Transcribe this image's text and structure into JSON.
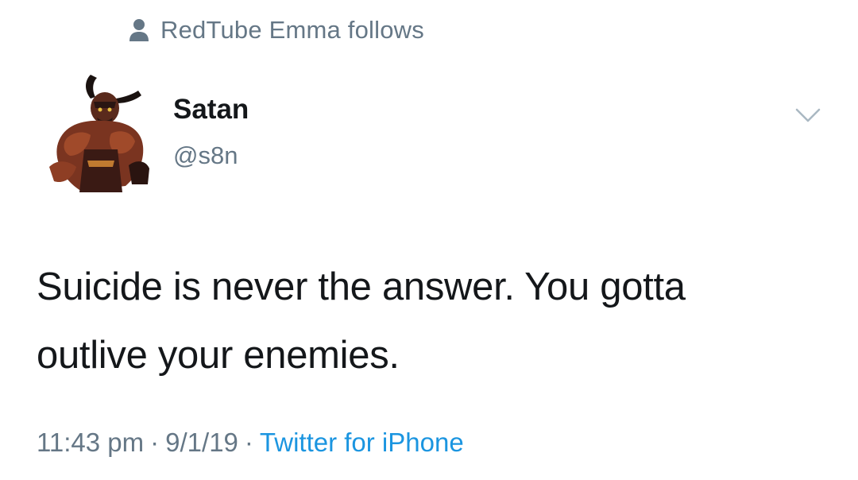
{
  "context": {
    "icon": "person-icon",
    "text": "RedTube Emma follows"
  },
  "author": {
    "avatar_icon": "demon-avatar",
    "display_name": "Satan",
    "handle": "@s8n"
  },
  "menu": {
    "icon": "chevron-down-icon"
  },
  "tweet": {
    "line1": "Suicide is never the answer. You gotta",
    "line2": "outlive your enemies."
  },
  "meta": {
    "time": "11:43 pm",
    "separator": "·",
    "date": "9/1/19",
    "source": "Twitter for iPhone"
  },
  "colors": {
    "primary_text": "#14171a",
    "secondary_text": "#657786",
    "link": "#1b95e0",
    "background": "#ffffff"
  }
}
